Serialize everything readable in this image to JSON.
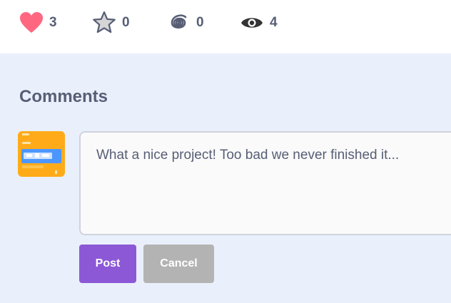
{
  "stats": {
    "loves": {
      "icon": "heart-icon",
      "count": "3",
      "color": "#ff6680"
    },
    "favorites": {
      "icon": "star-icon",
      "count": "0",
      "color": "#d0d0d0"
    },
    "remixes": {
      "icon": "spiral-icon",
      "count": "0",
      "color": "#575e75"
    },
    "views": {
      "icon": "eye-icon",
      "count": "4",
      "color": "#333333"
    }
  },
  "comments": {
    "title": "Comments",
    "input_text": "What a nice project! Too bad we never finished it...",
    "post_label": "Post",
    "cancel_label": "Cancel"
  },
  "colors": {
    "accent": "#8c58d6",
    "cancel": "#b3b3b3",
    "text": "#575e75",
    "background": "#e9f0fb"
  }
}
